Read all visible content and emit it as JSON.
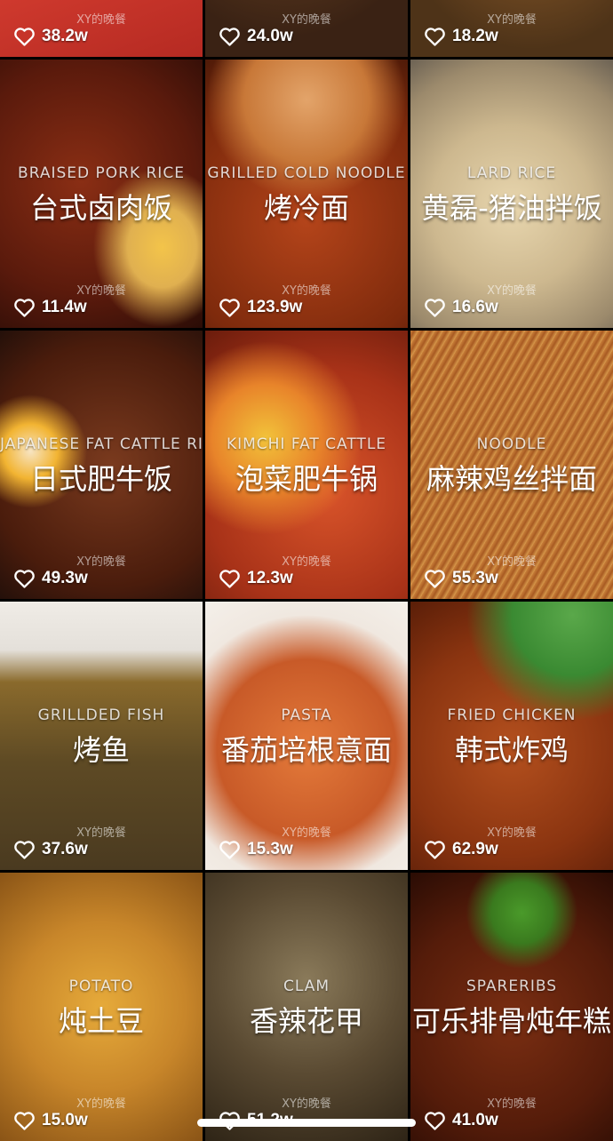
{
  "watermark": "XY的晚餐",
  "videos": [
    {
      "en": "",
      "cn": "",
      "likes": "38.2w",
      "bg": "linear-gradient(160deg,#f1e6d8 0%,#e6b6a5 35%,#d03a2e 60%,#b52a22 100%)"
    },
    {
      "en": "",
      "cn": "",
      "likes": "24.0w",
      "bg": "radial-gradient(circle at 40% 40%,#6b4423 0%,#3a2214 70%)"
    },
    {
      "en": "",
      "cn": "",
      "likes": "18.2w",
      "bg": "radial-gradient(circle at 60% 50%,#8a5a2a 0%,#4e3318 70%)"
    },
    {
      "en": "BRAISED PORK RICE",
      "cn": "台式卤肉饭",
      "likes": "11.4w",
      "bg": "radial-gradient(ellipse at 80% 70%,#f3c44a 0%,#e0b050 15%,transparent 30%),radial-gradient(circle at 40% 45%,#8a2e14 0%,#5a1a0c 60%,#2a0c06 100%)"
    },
    {
      "en": "GRILLED COLD NOODLE",
      "cn": "烤冷面",
      "likes": "123.9w",
      "bg": "radial-gradient(circle at 50% 15%,#e3a46a 0%,#c87838 25%,transparent 40%),radial-gradient(circle at 50% 60%,#b4441a 0%,#7e2a0c 70%,#4e1a08 100%)"
    },
    {
      "en": "LARD RICE",
      "cn": "黄磊-猪油拌饭",
      "likes": "16.6w",
      "bg": "radial-gradient(circle at 50% 55%,#e8d6ae 0%,#cdb88f 45%,#9c8a6c 80%,#6c6254 100%)"
    },
    {
      "en": "JAPANESE FAT CATTLE RICE",
      "cn": "日式肥牛饭",
      "likes": "49.3w",
      "bg": "radial-gradient(circle at 15% 45%,#f7e4c2 0%,#f2b432 12%,transparent 25%),radial-gradient(circle at 55% 50%,#7a3a1e 0%,#4a1c0c 70%,#24100a 100%)"
    },
    {
      "en": "KIMCHI FAT CATTLE",
      "cn": "泡菜肥牛锅",
      "likes": "12.3w",
      "bg": "radial-gradient(circle at 30% 40%,#f2c23a 0%,#e8842a 25%,transparent 45%),radial-gradient(circle at 60% 60%,#d9542a 0%,#a83218 60%,#6a1c0c 100%)"
    },
    {
      "en": "NOODLE",
      "cn": "麻辣鸡丝拌面",
      "likes": "55.3w",
      "bg": "repeating-linear-gradient(120deg,#c9803a 0px,#a85a22 4px,#d89a4c 8px),radial-gradient(circle,#a85a22,#6a3412)"
    },
    {
      "en": "GRILLDED FISH",
      "cn": "烤鱼",
      "likes": "37.6w",
      "bg": "linear-gradient(180deg,#f0ece6 0%,#e4e0da 18%,#8a6a2c 30%,#5e4a24 60%,#4a3a20 100%)"
    },
    {
      "en": "PASTA",
      "cn": "番茄培根意面",
      "likes": "15.3w",
      "bg": "radial-gradient(circle at 50% 55%,#e47a3a 0%,#c85a28 50%,#f0e8e0 75%,#f4f0ea 100%)"
    },
    {
      "en": "FRIED CHICKEN",
      "cn": "韩式炸鸡",
      "likes": "62.9w",
      "bg": "radial-gradient(circle at 80% 5%,#5aa84a 0%,#3a8a32 20%,transparent 35%),radial-gradient(circle at 50% 55%,#b4501e 0%,#8a3410 60%,#5a1e08 100%)"
    },
    {
      "en": "POTATO",
      "cn": "炖土豆",
      "likes": "15.0w",
      "bg": "radial-gradient(circle at 50% 50%,#e6aa3a 0%,#c8862a 50%,#8a5416 100%)"
    },
    {
      "en": "CLAM",
      "cn": "香辣花甲",
      "likes": "51.2w",
      "bg": "radial-gradient(circle at 50% 40%,#8a7a5a 0%,#5a4a32 50%,#2e2416 100%)"
    },
    {
      "en": "SPARERIBS",
      "cn": "可乐排骨炖年糕",
      "likes": "41.0w",
      "bg": "radial-gradient(circle at 55% 15%,#4a9a2a 0%,#3a7a1e 12%,transparent 22%),radial-gradient(circle at 50% 55%,#7a2e12 0%,#551c0a 60%,#2a0c04 100%)"
    }
  ]
}
